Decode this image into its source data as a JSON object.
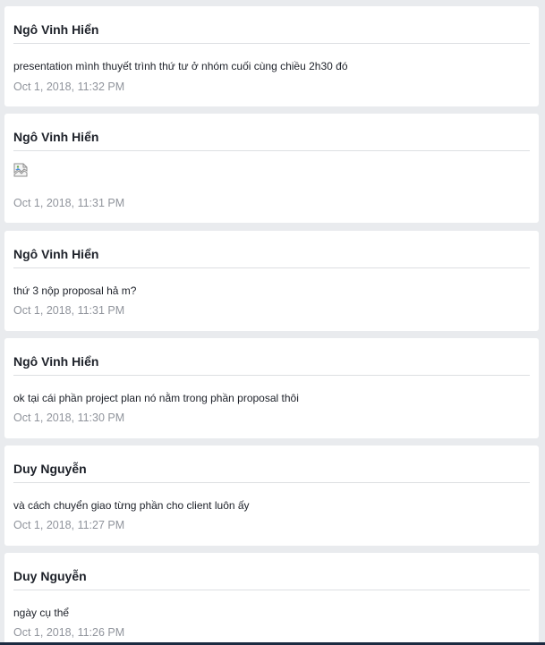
{
  "posts": [
    {
      "author": "Ngô Vinh Hiển",
      "message": "presentation mình thuyết trình thứ tư ở nhóm cuối cùng chiều 2h30 đó",
      "time": "Oct 1, 2018, 11:32 PM"
    },
    {
      "author": "Ngô Vinh Hiển",
      "image": "broken-image-icon",
      "time": "Oct 1, 2018, 11:31 PM"
    },
    {
      "author": "Ngô Vinh Hiển",
      "message": "thứ 3 nộp proposal hả m?",
      "time": "Oct 1, 2018, 11:31 PM"
    },
    {
      "author": "Ngô Vinh Hiển",
      "message": "ok tại cái phần project plan nó nằm trong phần proposal thôi",
      "time": "Oct 1, 2018, 11:30 PM"
    },
    {
      "author": "Duy Nguyễn",
      "message": "và cách chuyển giao từng phần cho client luôn ấy",
      "time": "Oct 1, 2018, 11:27 PM"
    },
    {
      "author": "Duy Nguyễn",
      "message": "ngày cụ thể",
      "time": "Oct 1, 2018, 11:26 PM"
    }
  ],
  "colors": {
    "background": "#e9ebee",
    "card": "#ffffff",
    "author_text": "#1d2129",
    "timestamp_text": "#90949c",
    "divider": "#dddfe2"
  }
}
